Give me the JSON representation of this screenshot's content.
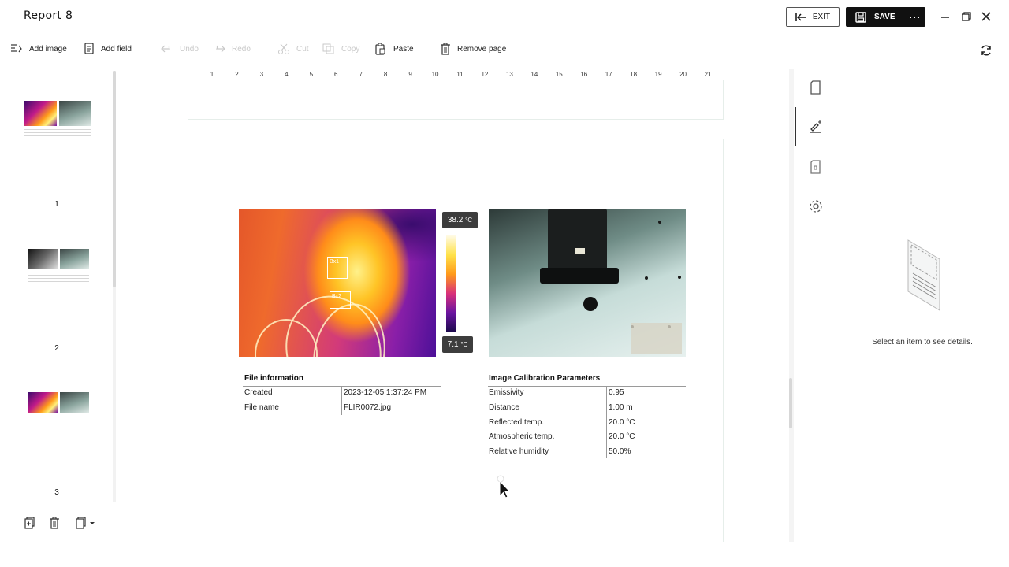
{
  "app": {
    "title": "Report 8"
  },
  "header": {
    "exit_label": "EXIT",
    "save_label": "SAVE",
    "more_label": "···"
  },
  "toolbar": {
    "add_image": "Add image",
    "add_field": "Add field",
    "undo": "Undo",
    "redo": "Redo",
    "cut": "Cut",
    "copy": "Copy",
    "paste": "Paste",
    "remove_page": "Remove page"
  },
  "pages": [
    {
      "number": "1"
    },
    {
      "number": "2"
    },
    {
      "number": "3"
    }
  ],
  "ruler": {
    "ticks": [
      "1",
      "2",
      "3",
      "4",
      "5",
      "6",
      "7",
      "8",
      "9",
      "10",
      "11",
      "12",
      "13",
      "14",
      "15",
      "16",
      "17",
      "18",
      "19",
      "20",
      "21"
    ]
  },
  "thermal": {
    "max_temp": "38.2",
    "min_temp": "7.1",
    "unit": "°C",
    "box_labels": [
      "Bx1",
      "Bx2"
    ]
  },
  "file_info": {
    "title": "File information",
    "rows": [
      {
        "label": "Created",
        "value": "2023-12-05 1:37:24 PM"
      },
      {
        "label": "File name",
        "value": "FLIR0072.jpg"
      }
    ]
  },
  "calibration": {
    "title": "Image Calibration Parameters",
    "rows": [
      {
        "label": "Emissivity",
        "value": "0.95"
      },
      {
        "label": "Distance",
        "value": "1.00 m"
      },
      {
        "label": "Reflected temp.",
        "value": "20.0 °C"
      },
      {
        "label": "Atmospheric temp.",
        "value": "20.0 °C"
      },
      {
        "label": "Relative humidity",
        "value": "50.0%"
      }
    ]
  },
  "details": {
    "empty_text": "Select an item to see details."
  }
}
